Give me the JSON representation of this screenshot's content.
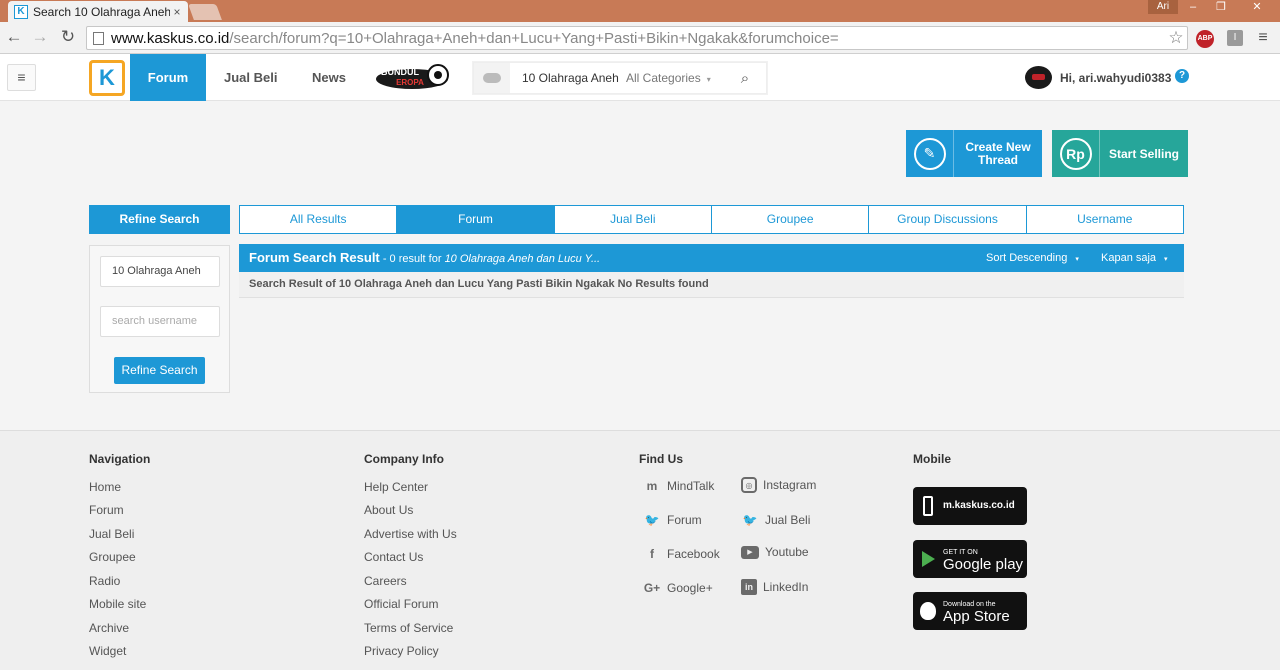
{
  "browser": {
    "tab_title": "Search 10 Olahraga Aneh",
    "tab_favicon": "K",
    "tab_close": "×",
    "user_label": "Ari",
    "window_controls": {
      "minimize": "–",
      "maximize": "❐",
      "close": "✕"
    },
    "url_host": "www.kaskus.co.id",
    "url_path": "/search/forum?q=10+Olahraga+Aneh+dan+Lucu+Yang+Pasti+Bikin+Ngakak&forumchoice=",
    "nav_icons": {
      "back": "←",
      "forward": "→",
      "reload": "↻",
      "star": "☆",
      "menu": "≡"
    },
    "extensions": {
      "adblock": "ABP",
      "other": "I"
    }
  },
  "header": {
    "menu_icon": "≡",
    "logo_letter": "K",
    "nav": {
      "forum": "Forum",
      "jual_beli": "Jual Beli",
      "news": "News"
    },
    "bundul_logo": {
      "line1": "BUNDUL",
      "line2": "EROPA"
    },
    "search": {
      "query": "10 Olahraga Aneh",
      "category": "All Categories",
      "caret": "▾",
      "go_icon": "⌕"
    },
    "greeting": "Hi, ari.wahyudi0383",
    "help": "?"
  },
  "actions": {
    "create_thread": "Create New Thread",
    "create_icon": "✎",
    "start_selling": "Start Selling",
    "sell_icon": "Rp"
  },
  "sidebar": {
    "title": "Refine Search",
    "query_value": "10 Olahraga Aneh",
    "username_placeholder": "search username",
    "button": "Refine Search"
  },
  "tabs": [
    "All Results",
    "Forum",
    "Jual Beli",
    "Groupee",
    "Group Discussions",
    "Username"
  ],
  "results": {
    "title": "Forum Search Result",
    "subtitle_prefix": " - 0 result for ",
    "subtitle_query": "10 Olahraga Aneh dan Lucu Y...",
    "sort": "Sort Descending",
    "time": "Kapan saja",
    "caret": "▾",
    "message": "Search Result of 10 Olahraga Aneh dan Lucu Yang Pasti Bikin Ngakak No Results found"
  },
  "footer": {
    "navigation": {
      "title": "Navigation",
      "links": [
        "Home",
        "Forum",
        "Jual Beli",
        "Groupee",
        "Radio",
        "Mobile site",
        "Archive",
        "Widget"
      ]
    },
    "company": {
      "title": "Company Info",
      "links": [
        "Help Center",
        "About Us",
        "Advertise with Us",
        "Contact Us",
        "Careers",
        "Official Forum",
        "Terms of Service",
        "Privacy Policy"
      ]
    },
    "find_us": {
      "title": "Find Us",
      "items": [
        {
          "label": "MindTalk",
          "icon": "m"
        },
        {
          "label": "Instagram",
          "icon": "◎"
        },
        {
          "label": "Forum",
          "icon": "🐦"
        },
        {
          "label": "Jual Beli",
          "icon": "🐦"
        },
        {
          "label": "Facebook",
          "icon": "f"
        },
        {
          "label": "Youtube",
          "icon": "▶"
        },
        {
          "label": "Google+",
          "icon": "G+"
        },
        {
          "label": "LinkedIn",
          "icon": "in"
        }
      ]
    },
    "mobile": {
      "title": "Mobile",
      "site": "m.kaskus.co.id",
      "google_small": "GET IT ON",
      "google_big": "Google play",
      "apple_small": "Download on the",
      "apple_big": "App Store"
    }
  }
}
